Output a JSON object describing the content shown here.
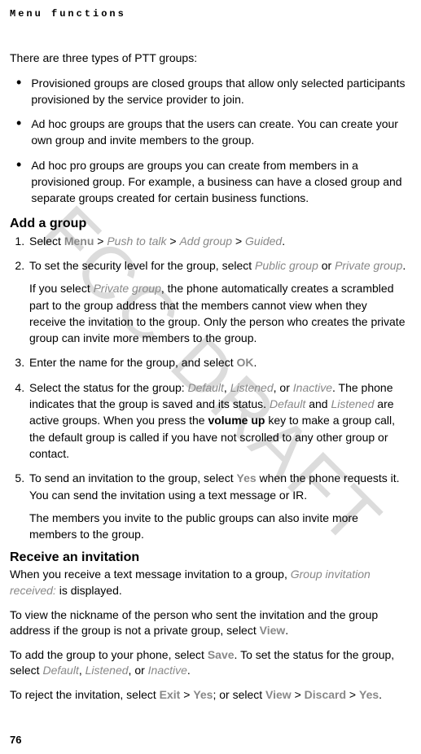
{
  "header": "Menu functions",
  "watermark": "FCC DRAFT",
  "intro": "There are three types of PTT groups:",
  "bullets": [
    "Provisioned groups are closed groups that allow only selected participants provisioned by the service provider to join.",
    "Ad hoc groups are groups that the users can create. You can create your own group and invite members to the group.",
    "Ad hoc pro groups are groups you can create from members in a provisioned group. For example, a business can have a closed group and separate groups created for certain business functions."
  ],
  "sectionA": {
    "title": "Add a group",
    "steps": {
      "s1": {
        "pre": "Select ",
        "menu": "Menu",
        "gt1": " > ",
        "ptt": "Push to talk",
        "gt2": " > ",
        "addgroup": "Add group",
        "gt3": " > ",
        "guided": "Guided",
        "end": "."
      },
      "s2": {
        "line1_pre": "To set the security level for the group, select ",
        "pub": "Public group",
        "or": " or ",
        "priv": "Private group",
        "end": ".",
        "para2_pre": "If you select ",
        "para2_priv": "Private group",
        "para2_rest": ", the phone automatically creates a scrambled part to the group address that the members cannot view when they receive the invitation to the group. Only the person who creates the private group can invite more members to the group."
      },
      "s3": {
        "pre": "Enter the name for the group, and select ",
        "ok": "OK",
        "end": "."
      },
      "s4": {
        "pre": "Select the status for the group: ",
        "def": "Default",
        "c1": ", ",
        "lis": "Listened",
        "c2": ", or ",
        "inact": "Inactive",
        "mid1": ". The phone indicates that the group is saved and its status. ",
        "def2": "Default",
        "and": " and ",
        "lis2": "Listened",
        "mid2": " are active groups. When you press the ",
        "volup": "volume up",
        "rest": " key to make a group call, the default group is called if you have not scrolled to any other group or contact."
      },
      "s5": {
        "pre": "To send an invitation to the group, select ",
        "yes": "Yes",
        "mid": " when the phone requests it. You can send the invitation using a text message or IR.",
        "para2": "The members you invite to the public groups can also invite more members to the group."
      }
    }
  },
  "sectionB": {
    "title": "Receive an invitation",
    "p1_pre": "When you receive a text message invitation to a group, ",
    "p1_emph": "Group invitation received:",
    "p1_post": " is displayed.",
    "p2_pre": "To view the nickname of the person who sent the invitation and the group address if the group is not a private group, select ",
    "p2_view": "View",
    "p2_end": ".",
    "p3_pre": "To add the group to your phone, select ",
    "p3_save": "Save",
    "p3_mid": ". To set the status for the group, select ",
    "p3_def": "Default",
    "p3_c1": ", ",
    "p3_lis": "Listened",
    "p3_c2": ", or ",
    "p3_inact": "Inactive",
    "p3_end": ".",
    "p4_pre": "To reject the invitation, select ",
    "p4_exit": "Exit",
    "p4_gt1": " > ",
    "p4_yes1": "Yes",
    "p4_mid": "; or select ",
    "p4_view": "View",
    "p4_gt2": " > ",
    "p4_discard": "Discard",
    "p4_gt3": " > ",
    "p4_yes2": "Yes",
    "p4_end": "."
  },
  "pageNumber": "76"
}
